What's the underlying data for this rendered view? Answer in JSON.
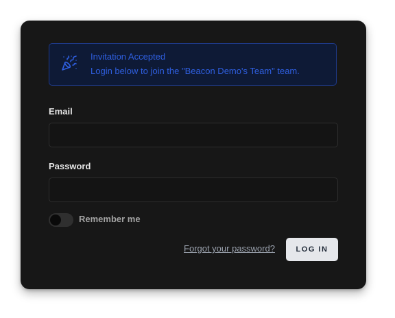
{
  "alert": {
    "icon": "party-popper-icon",
    "title": "Invitation Accepted",
    "message": "Login below to join the \"Beacon Demo's Team\" team."
  },
  "form": {
    "email_label": "Email",
    "email_value": "",
    "password_label": "Password",
    "password_value": "",
    "remember_label": "Remember me",
    "remember_checked": false,
    "forgot_link": "Forgot your password?",
    "login_button": "LOG IN"
  },
  "colors": {
    "card_background": "#171717",
    "alert_text": "#2f5fe0",
    "alert_border": "#1e3a8a",
    "button_background": "#e5e7eb"
  }
}
